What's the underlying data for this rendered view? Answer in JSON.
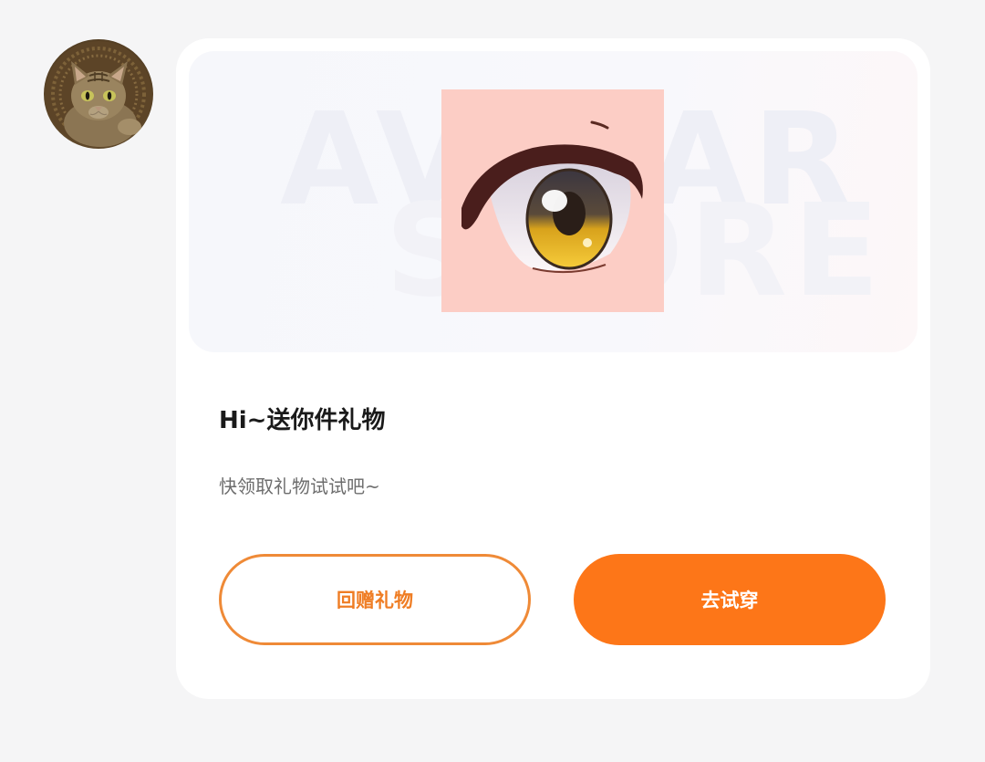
{
  "sender": {
    "avatar_icon": "cat-avatar-icon"
  },
  "gift_card": {
    "banner": {
      "watermark_line1": "AVATAR",
      "watermark_line2": "STORE",
      "item_icon": "anime-eye-icon"
    },
    "title": "Hi~送你件礼物",
    "subtitle": "快领取礼物试试吧~",
    "return_gift_label": "回赠礼物",
    "try_on_label": "去试穿"
  },
  "colors": {
    "page_background": "#f5f5f6",
    "card_background": "#ffffff",
    "accent_orange": "#fd7618",
    "outline_orange": "#ef8a37",
    "item_background": "#fccdc5"
  }
}
